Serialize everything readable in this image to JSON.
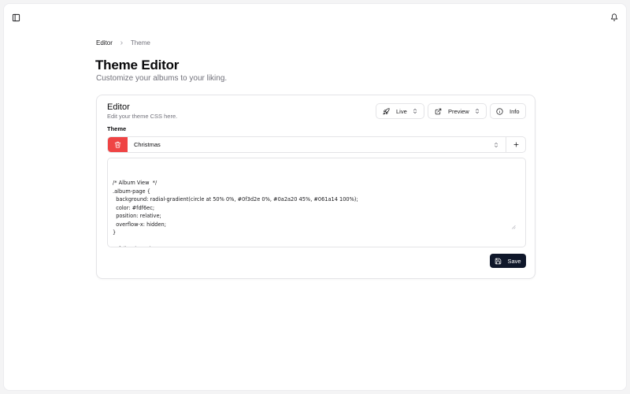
{
  "breadcrumb": {
    "parent": "Editor",
    "current": "Theme"
  },
  "header": {
    "title": "Theme Editor",
    "subtitle": "Customize your albums to your liking."
  },
  "editor_card": {
    "title": "Editor",
    "description": "Edit your theme CSS here.",
    "controls": {
      "live_label": "Live",
      "preview_label": "Preview",
      "info_label": "Info"
    },
    "theme_label": "Theme",
    "theme_selected": "Christmas",
    "css_code": "/* Album View  */\n.album-page {\n  background: radial-gradient(circle at 50% 0%, #0f3d2e 0%, #0a2a20 45%, #061a14 100%);\n  color: #fdf6ec;\n  position: relative;\n  overflow-x: hidden;\n}\n\n/* fallender Schnee */\n.album-page::before,\n.media-page::before {",
    "save_label": "Save"
  },
  "icons": {
    "sidebar_toggle": "panel-left-icon",
    "notifications": "bell-icon",
    "live": "rocket-icon",
    "preview": "external-link-icon",
    "info": "info-circle-icon",
    "delete": "trash-icon",
    "add": "plus-icon",
    "select": "chevrons-up-down-icon",
    "save": "save-icon"
  },
  "colors": {
    "danger": "#ef4444",
    "primary": "#0f172a"
  }
}
